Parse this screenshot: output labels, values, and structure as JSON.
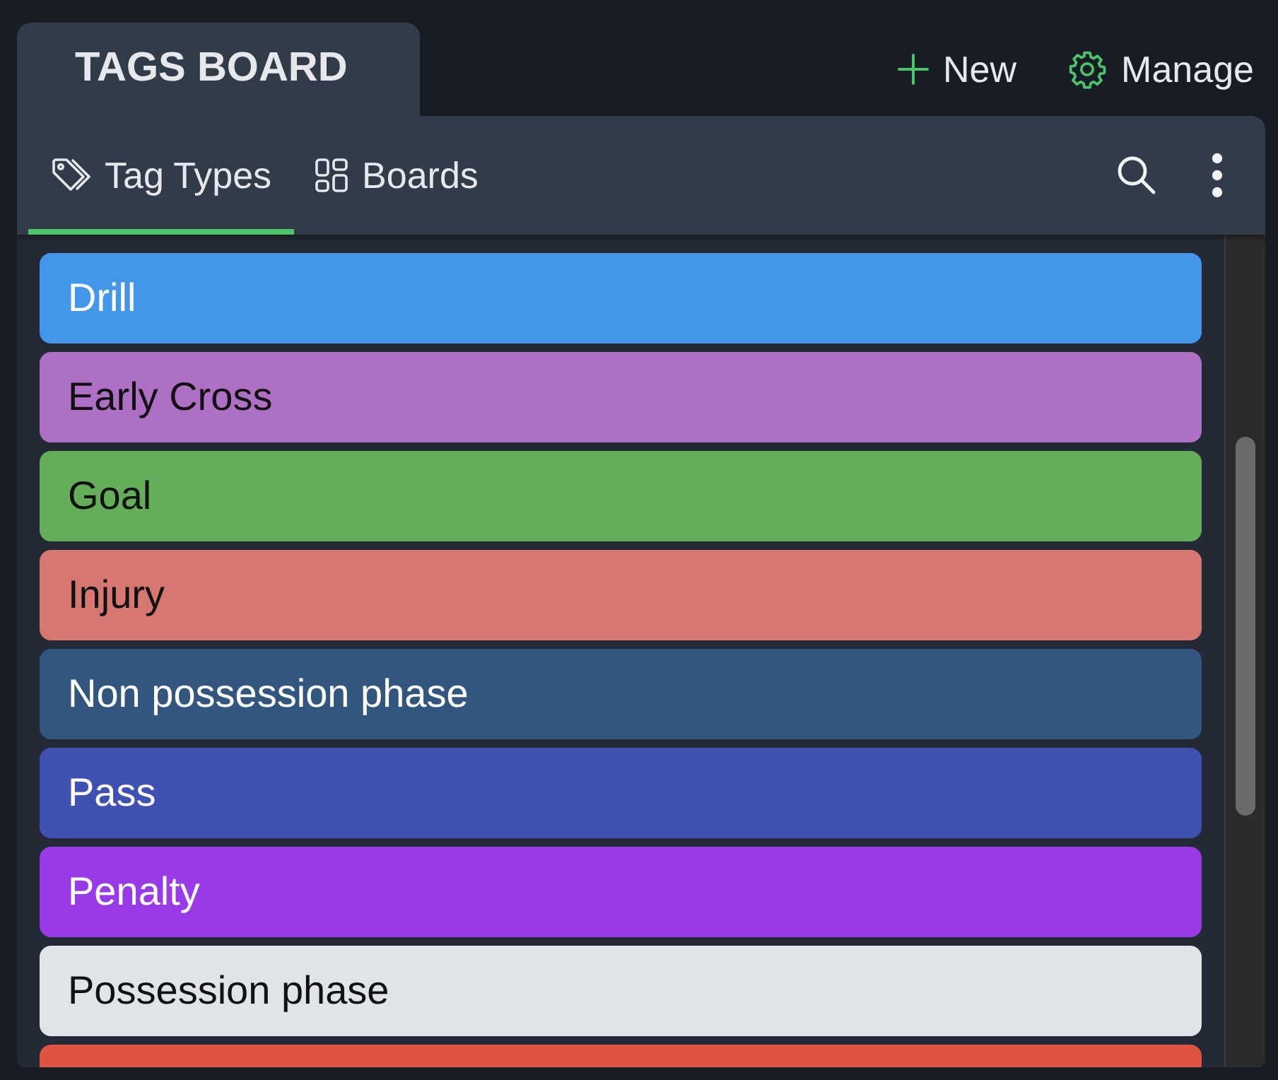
{
  "header": {
    "title": "TAGS BOARD",
    "actions": [
      {
        "kind": "new",
        "label": "New"
      },
      {
        "kind": "manage",
        "label": "Manage"
      }
    ]
  },
  "tabs": [
    {
      "kind": "tag",
      "label": "Tag Types",
      "selected": true
    },
    {
      "kind": "boards",
      "label": "Boards",
      "selected": false
    }
  ],
  "tags": [
    {
      "label": "Drill",
      "color": "#4496e8"
    },
    {
      "label": "Early Cross",
      "color": "#ae70c4"
    },
    {
      "label": "Goal",
      "color": "#65ac5b"
    },
    {
      "label": "Injury",
      "color": "#d77772"
    },
    {
      "label": "Non possession phase",
      "color": "#33567e"
    },
    {
      "label": "Pass",
      "color": "#3f51b3"
    },
    {
      "label": "Penalty",
      "color": "#983ae8"
    },
    {
      "label": "Possession phase",
      "color": "#e0e3e8"
    },
    {
      "color": "#e05242"
    }
  ]
}
